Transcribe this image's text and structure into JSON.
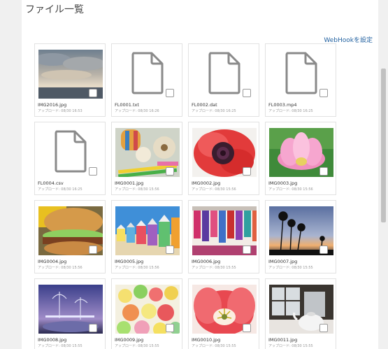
{
  "page": {
    "title": "ファイル一覧",
    "webhook_label": "WebHookを設定"
  },
  "files": [
    {
      "name": "IMG2016.jpg",
      "uploaded": "アップロード: 08/30 16:53",
      "kind": "image",
      "image": "clouds"
    },
    {
      "name": "FL0001.txt",
      "uploaded": "アップロード: 08/30 16:26",
      "kind": "file",
      "image": "file-icon"
    },
    {
      "name": "FL0002.dat",
      "uploaded": "アップロード: 08/30 16:25",
      "kind": "file",
      "image": "file-icon"
    },
    {
      "name": "FL0003.mp4",
      "uploaded": "アップロード: 08/30 16:25",
      "kind": "file",
      "image": "file-icon"
    },
    {
      "name": "FL0004.csv",
      "uploaded": "アップロード: 08/30 16:25",
      "kind": "file",
      "image": "file-icon"
    },
    {
      "name": "IMG0001.jpg",
      "uploaded": "アップロード: 08/30 15:56",
      "kind": "image",
      "image": "craft"
    },
    {
      "name": "IMG0002.jpg",
      "uploaded": "アップロード: 08/30 15:56",
      "kind": "image",
      "image": "anemone"
    },
    {
      "name": "IMG0003.jpg",
      "uploaded": "アップロード: 08/30 15:56",
      "kind": "image",
      "image": "lotus"
    },
    {
      "name": "IMG0004.jpg",
      "uploaded": "アップロード: 08/30 15:56",
      "kind": "image",
      "image": "burger"
    },
    {
      "name": "IMG0005.jpg",
      "uploaded": "アップロード: 08/30 15:56",
      "kind": "image",
      "image": "beach-huts"
    },
    {
      "name": "IMG0006.jpg",
      "uploaded": "アップロード: 08/30 15:55",
      "kind": "image",
      "image": "fabrics"
    },
    {
      "name": "IMG0007.jpg",
      "uploaded": "アップロード: 08/30 15:55",
      "kind": "image",
      "image": "palms-sunset"
    },
    {
      "name": "IMG0008.jpg",
      "uploaded": "アップロード: 08/30 15:55",
      "kind": "image",
      "image": "night-palms"
    },
    {
      "name": "IMG0009.jpg",
      "uploaded": "アップロード: 08/30 15:55",
      "kind": "image",
      "image": "candies"
    },
    {
      "name": "IMG0010.jpg",
      "uploaded": "アップロード: 08/30 15:55",
      "kind": "image",
      "image": "tulip"
    },
    {
      "name": "IMG0011.jpg",
      "uploaded": "アップロード: 08/30 15:55",
      "kind": "image",
      "image": "teapot-room"
    }
  ]
}
